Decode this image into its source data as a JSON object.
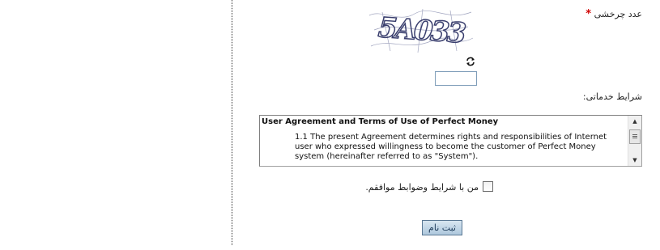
{
  "captcha": {
    "label": "عدد چرخشی",
    "required_mark": "*",
    "image_text": "5A033",
    "input_value": ""
  },
  "terms": {
    "label": "شرایط خدماتی:",
    "title": "User Agreement and Terms of Use of Perfect Money",
    "body": "1.1 The present Agreement determines rights and responsibilities of Internet user who expressed willingness to become the customer of Perfect Money system (hereinafter referred to as \"System\")."
  },
  "agree": {
    "label": "من با شرایط وضوابط موافقم.",
    "checked": false
  },
  "register": {
    "label": "ثبت نام"
  },
  "colors": {
    "required": "#d00000",
    "button_top": "#d8e6f1",
    "button_bottom": "#aec8dd",
    "captcha_ink": "#3a3f6e"
  }
}
